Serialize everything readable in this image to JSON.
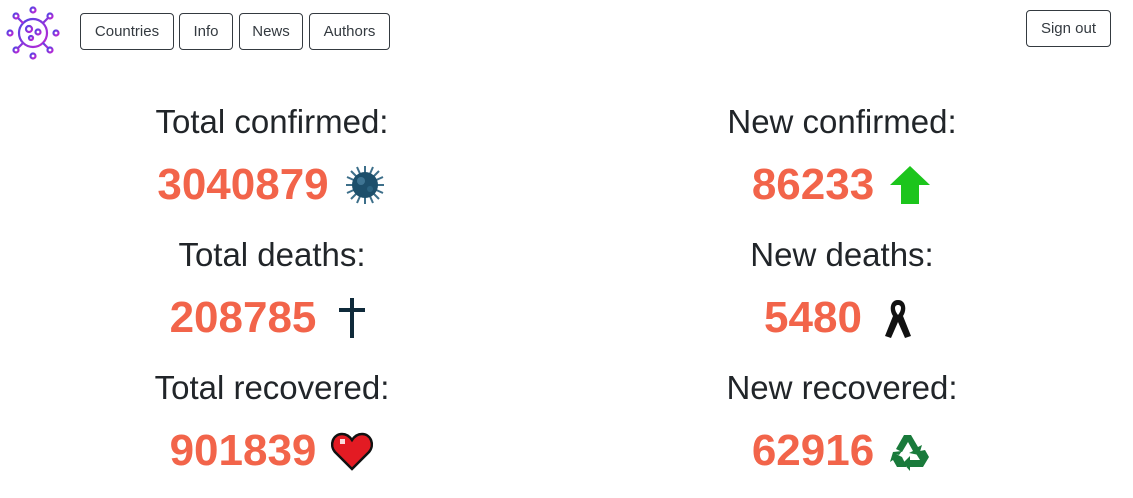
{
  "nav": {
    "buttons": [
      "Countries",
      "Info",
      "News",
      "Authors"
    ],
    "signout_label": "Sign out"
  },
  "stats": {
    "total_confirmed": {
      "label": "Total confirmed:",
      "value": "3040879",
      "icon": "virus-icon"
    },
    "new_confirmed": {
      "label": "New confirmed:",
      "value": "86233",
      "icon": "arrow-up-icon"
    },
    "total_deaths": {
      "label": "Total deaths:",
      "value": "208785",
      "icon": "cross-icon"
    },
    "new_deaths": {
      "label": "New deaths:",
      "value": "5480",
      "icon": "ribbon-icon"
    },
    "total_recovered": {
      "label": "Total recovered:",
      "value": "901839",
      "icon": "heart-icon"
    },
    "new_recovered": {
      "label": "New recovered:",
      "value": "62916",
      "icon": "recycle-icon"
    }
  },
  "colors": {
    "value": "#f2644a",
    "arrow": "#1cc51c",
    "recycle": "#197a3b",
    "logo_start": "#4f46e5",
    "logo_end": "#c026d3"
  }
}
